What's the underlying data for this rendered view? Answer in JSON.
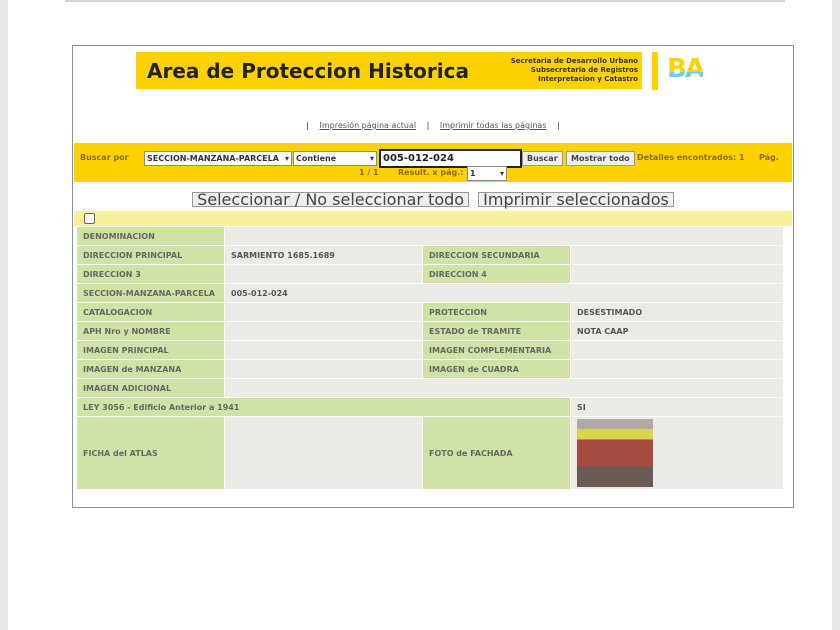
{
  "header": {
    "title": "Area de Proteccion Historica",
    "subtitle_lines": [
      "Secretaria de Desarrollo Urbano",
      "Subsecretaria de Registros",
      "Interpretacion y Catastro"
    ],
    "logo": "BA"
  },
  "links": {
    "sep": "|",
    "current": "Impresión página actual",
    "all": "Imprimir todas las páginas"
  },
  "search": {
    "label": "Buscar por",
    "field": "SECCION-MANZANA-PARCELA",
    "operator": "Contiene",
    "value": "005-012-024",
    "buscar": "Buscar",
    "mostrar": "Mostrar todo",
    "found": "Detalles encontrados: 1",
    "pag": "Pág.",
    "page": "1 / 1",
    "per_page_label": "Result. x pág.:",
    "per_page": "1"
  },
  "actions": {
    "select_all": "Seleccionar / No seleccionar todo",
    "print_selected": "Imprimir seleccionados"
  },
  "record": {
    "denominacion": {
      "label": "DENOMINACION",
      "value": ""
    },
    "dir_principal": {
      "label": "DIRECCION PRINCIPAL",
      "value": "SARMIENTO 1685.1689"
    },
    "dir_secundaria": {
      "label": "DIRECCION SECUNDARIA",
      "value": ""
    },
    "dir3": {
      "label": "DIRECCION 3",
      "value": ""
    },
    "dir4": {
      "label": "DIRECCION 4",
      "value": ""
    },
    "smp": {
      "label": "SECCION-MANZANA-PARCELA",
      "value": "005-012-024"
    },
    "catalogacion": {
      "label": "CATALOGACION",
      "value": ""
    },
    "proteccion": {
      "label": "PROTECCION",
      "value": "DESESTIMADO"
    },
    "aph": {
      "label": "APH Nro y NOMBRE",
      "value": ""
    },
    "estado": {
      "label": "ESTADO de TRAMITE",
      "value": "NOTA CAAP"
    },
    "img_principal": {
      "label": "IMAGEN PRINCIPAL",
      "value": ""
    },
    "img_complementaria": {
      "label": "IMAGEN COMPLEMENTARIA",
      "value": ""
    },
    "img_manzana": {
      "label": "IMAGEN de MANZANA",
      "value": ""
    },
    "img_cuadra": {
      "label": "IMAGEN de CUADRA",
      "value": ""
    },
    "img_adicional": {
      "label": "IMAGEN ADICIONAL",
      "value": ""
    },
    "ley": {
      "label": "LEY 3056 - Edificio Anterior a 1941",
      "value": "SI"
    },
    "ficha": {
      "label": "FICHA del ATLAS",
      "value": ""
    },
    "foto": {
      "label": "FOTO de FACHADA"
    }
  }
}
